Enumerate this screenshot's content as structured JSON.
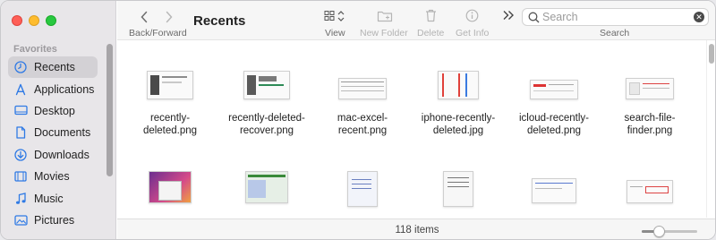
{
  "window": {
    "title": "Recents"
  },
  "sidebar": {
    "section": "Favorites",
    "items": [
      {
        "label": "Recents",
        "icon": "clock-icon",
        "active": true
      },
      {
        "label": "Applications",
        "icon": "applications-icon"
      },
      {
        "label": "Desktop",
        "icon": "desktop-icon"
      },
      {
        "label": "Documents",
        "icon": "document-icon"
      },
      {
        "label": "Downloads",
        "icon": "download-icon"
      },
      {
        "label": "Movies",
        "icon": "film-icon"
      },
      {
        "label": "Music",
        "icon": "music-note-icon"
      },
      {
        "label": "Pictures",
        "icon": "pictures-icon"
      }
    ]
  },
  "toolbar": {
    "back_forward_label": "Back/Forward",
    "view_label": "View",
    "new_folder_label": "New Folder",
    "delete_label": "Delete",
    "get_info_label": "Get Info",
    "search_label": "Search",
    "search_placeholder": "Search"
  },
  "files": [
    {
      "name": "recently-deleted.png",
      "line1": "recently-",
      "line2": "deleted.png"
    },
    {
      "name": "recently-deleted-recover.png",
      "line1": "recently-deleted-",
      "line2": "recover.png"
    },
    {
      "name": "mac-excel-recent.png",
      "line1": "mac-excel-",
      "line2": "recent.png"
    },
    {
      "name": "iphone-recently-deleted.jpg",
      "line1": "iphone-recently-",
      "line2": "deleted.jpg"
    },
    {
      "name": "icloud-recently-deleted.png",
      "line1": "icloud-recently-",
      "line2": "deleted.png"
    },
    {
      "name": "search-file-finder.png",
      "line1": "search-file-",
      "line2": "finder.png"
    }
  ],
  "status": {
    "items_count": "118 items",
    "zoom_level": 0.3
  },
  "colors": {
    "accent": "#2f7ae5",
    "sidebar_bg": "#e8e6e9",
    "selected_bg": "#d3d1d5"
  }
}
